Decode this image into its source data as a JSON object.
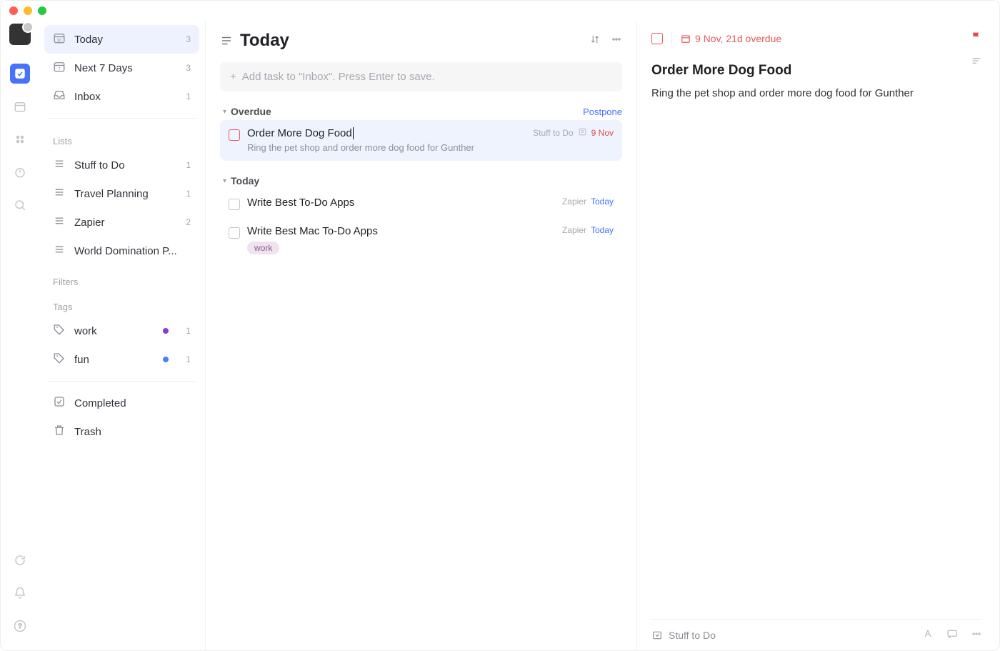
{
  "rail": {
    "icons": [
      "check",
      "calendar",
      "grid",
      "clock",
      "search"
    ],
    "bottom": [
      "sync",
      "bell",
      "help"
    ]
  },
  "sidebar": {
    "nav": [
      {
        "key": "today",
        "label": "Today",
        "count": "3",
        "icon": "calendar-today",
        "selected": true
      },
      {
        "key": "next7",
        "label": "Next 7 Days",
        "count": "3",
        "icon": "calendar-week"
      },
      {
        "key": "inbox",
        "label": "Inbox",
        "count": "1",
        "icon": "inbox"
      }
    ],
    "lists_label": "Lists",
    "lists": [
      {
        "label": "Stuff to Do",
        "count": "1"
      },
      {
        "label": "Travel Planning",
        "count": "1"
      },
      {
        "label": "Zapier",
        "count": "2"
      },
      {
        "label": "World Domination P...",
        "count": ""
      }
    ],
    "filters_label": "Filters",
    "tags_label": "Tags",
    "tags": [
      {
        "label": "work",
        "count": "1",
        "color": "#8a3fc6"
      },
      {
        "label": "fun",
        "count": "1",
        "color": "#3f86f5"
      }
    ],
    "footer": [
      {
        "key": "completed",
        "label": "Completed",
        "icon": "check-square"
      },
      {
        "key": "trash",
        "label": "Trash",
        "icon": "trash"
      }
    ]
  },
  "main": {
    "title": "Today",
    "add_placeholder": "Add task to \"Inbox\". Press Enter to save.",
    "groups": [
      {
        "title": "Overdue",
        "right_action": "Postpone",
        "tasks": [
          {
            "title": "Order More Dog Food",
            "subtitle": "Ring the pet shop and order more dog food for Gunther",
            "list": "Stuff to Do",
            "date": "9 Nov",
            "overdue": true,
            "selected": true,
            "has_meta_icon": true
          }
        ]
      },
      {
        "title": "Today",
        "right_action": "",
        "tasks": [
          {
            "title": "Write Best To-Do Apps",
            "list": "Zapier",
            "date": "Today"
          },
          {
            "title": "Write Best Mac To-Do Apps",
            "list": "Zapier",
            "date": "Today",
            "tag": "work"
          }
        ]
      }
    ]
  },
  "detail": {
    "date_text": "9 Nov, 21d overdue",
    "title": "Order More Dog Food",
    "description": "Ring the pet shop and order more dog food for Gunther",
    "footer_list": "Stuff to Do"
  }
}
